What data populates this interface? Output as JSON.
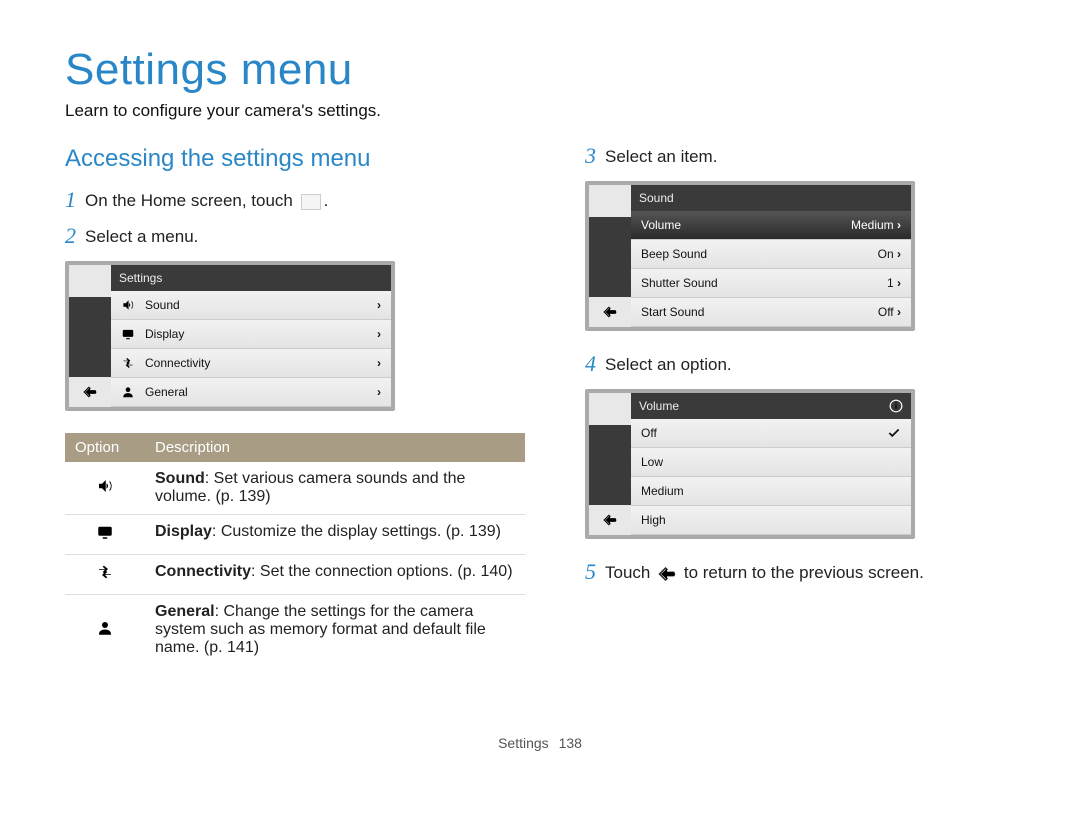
{
  "title": "Settings menu",
  "subtitle": "Learn to configure your camera's settings.",
  "section_heading": "Accessing the settings menu",
  "steps": {
    "s1": "On the Home screen, touch",
    "s1_suffix": ".",
    "s2": "Select a menu.",
    "s3": "Select an item.",
    "s4": "Select an option.",
    "s5_pre": "Touch",
    "s5_post": "to return to the previous screen."
  },
  "settings_screen": {
    "title": "Settings",
    "rows": [
      {
        "icon": "sound",
        "label": "Sound"
      },
      {
        "icon": "display",
        "label": "Display"
      },
      {
        "icon": "connectivity",
        "label": "Connectivity"
      },
      {
        "icon": "general",
        "label": "General"
      }
    ]
  },
  "options_table": {
    "headers": {
      "opt": "Option",
      "desc": "Description"
    },
    "rows": [
      {
        "name": "Sound",
        "text": ": Set various camera sounds and the volume. (p. 139)",
        "icon": "sound"
      },
      {
        "name": "Display",
        "text": ": Customize the display settings. (p. 139)",
        "icon": "display"
      },
      {
        "name": "Connectivity",
        "text": ": Set the connection options. (p. 140)",
        "icon": "connectivity"
      },
      {
        "name": "General",
        "text": ": Change the settings for the camera system such as memory format and default file name. (p. 141)",
        "icon": "general"
      }
    ]
  },
  "sound_screen": {
    "title": "Sound",
    "rows": [
      {
        "label": "Volume",
        "value": "Medium",
        "selected": true
      },
      {
        "label": "Beep Sound",
        "value": "On"
      },
      {
        "label": "Shutter Sound",
        "value": "1"
      },
      {
        "label": "Start Sound",
        "value": "Off"
      }
    ]
  },
  "volume_screen": {
    "title": "Volume",
    "rows": [
      {
        "label": "Off",
        "checked": true
      },
      {
        "label": "Low"
      },
      {
        "label": "Medium"
      },
      {
        "label": "High"
      }
    ]
  },
  "footer": {
    "section": "Settings",
    "page": "138"
  }
}
